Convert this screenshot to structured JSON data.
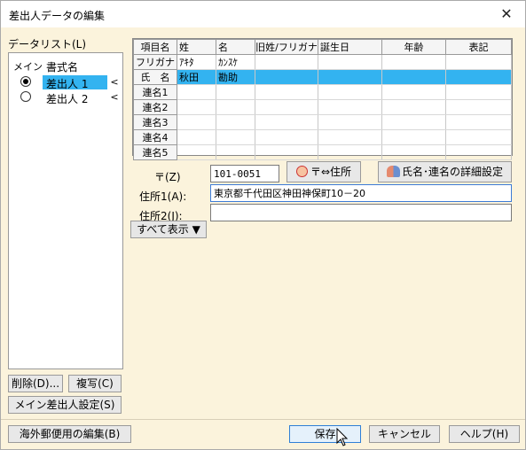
{
  "window": {
    "title": "差出人データの編集",
    "close_glyph": "✕"
  },
  "datalist": {
    "label": "データリスト(L)",
    "col_main": "メイン",
    "col_name": "書式名",
    "items": [
      {
        "name": "差出人 1",
        "selected": true,
        "arrow": "<"
      },
      {
        "name": "差出人 2",
        "selected": false,
        "arrow": "<"
      }
    ]
  },
  "grid": {
    "headers": [
      "項目名",
      "姓",
      "名",
      "旧姓/フリガナ",
      "誕生日",
      "年齢",
      "表記"
    ],
    "rows": [
      {
        "label": "フリガナ",
        "sei": "ｱｷﾀ",
        "mei": "ｶﾝｽｹ"
      },
      {
        "label": "氏　名",
        "sei": "秋田",
        "mei": "勘助"
      },
      {
        "label": "連名1",
        "sei": "",
        "mei": ""
      },
      {
        "label": "連名2",
        "sei": "",
        "mei": ""
      },
      {
        "label": "連名3",
        "sei": "",
        "mei": ""
      },
      {
        "label": "連名4",
        "sei": "",
        "mei": ""
      },
      {
        "label": "連名5",
        "sei": "",
        "mei": ""
      }
    ]
  },
  "form": {
    "postal_label": "〒(Z)",
    "postal_value": "101-0051",
    "postal_button": "〒⇔住所",
    "detail_button": "氏名･連名の詳細設定",
    "addr1_label": "住所1(A):",
    "addr1_value": "東京都千代田区神田神保町10－20",
    "addr2_label": "住所2(J):",
    "addr2_value": "",
    "show_all_button": "すべて表示 ▼"
  },
  "left_buttons": {
    "delete": "削除(D)...",
    "copy": "複写(C)",
    "main_sender": "メイン差出人設定(S)"
  },
  "footer": {
    "overseas": "海外郵便用の編集(B)",
    "save": "保存",
    "cancel": "キャンセル",
    "help": "ヘルプ(H)"
  }
}
